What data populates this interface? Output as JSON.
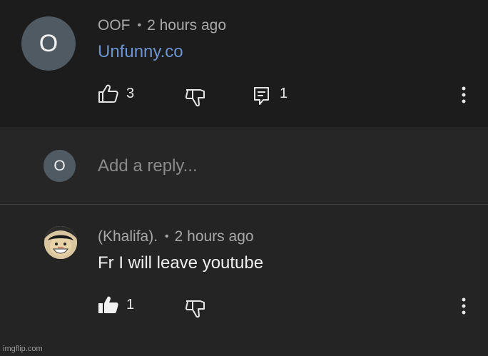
{
  "comment1": {
    "avatar_letter": "O",
    "author": "OOF",
    "separator": "•",
    "time": "2 hours ago",
    "text": "Unfunny.co",
    "likes": "3",
    "replies": "1"
  },
  "reply": {
    "avatar_letter": "O",
    "placeholder": "Add a reply..."
  },
  "comment2": {
    "author": "(Khalifa).",
    "separator": "•",
    "time": "2 hours ago",
    "text": "Fr I will leave youtube",
    "likes": "1"
  },
  "watermark": "imgflip.com",
  "icons": {
    "like": "thumbs-up-icon",
    "like_filled": "thumbs-up-filled-icon",
    "dislike": "thumbs-down-icon",
    "reply": "comment-icon",
    "more": "more-vertical-icon"
  },
  "colors": {
    "link": "#6d93cf",
    "avatar": "#4f5a63",
    "background": "#242424"
  }
}
